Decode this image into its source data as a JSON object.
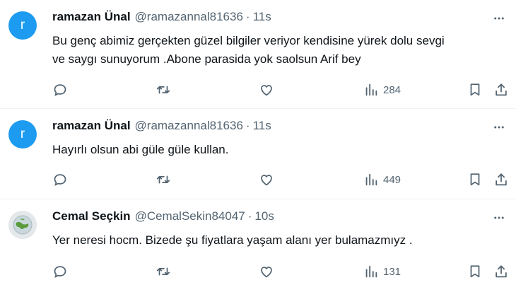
{
  "icons": {
    "reply": "reply-icon",
    "retweet": "retweet-icon",
    "like": "like-icon",
    "views": "views-icon",
    "bookmark": "bookmark-icon",
    "share": "share-icon",
    "more": "more-icon"
  },
  "colors": {
    "avatar_blue": "#1d9bf0",
    "icon_gray": "#536471"
  },
  "tweets": [
    {
      "avatar_letter": "r",
      "name": "ramazan Ünal",
      "handle": "@ramazannal81636",
      "separator": "·",
      "time": "11s",
      "text_lines": [
        "Bu genç abimiz  gerçekten güzel bilgiler veriyor kendisine yürek dolu sevgi",
        "ve saygı sunuyorum .Abone  parasida yok saolsun Arif bey"
      ],
      "views": "284"
    },
    {
      "avatar_letter": "r",
      "name": "ramazan Ünal",
      "handle": "@ramazannal81636",
      "separator": "·",
      "time": "11s",
      "text_lines": [
        "Hayırlı olsun abi güle güle kullan."
      ],
      "views": "449"
    },
    {
      "avatar_letter": "",
      "name": "Cemal Seçkin",
      "handle": "@CemalSekin84047",
      "separator": "·",
      "time": "10s",
      "text_lines": [
        "Yer neresi hocm. Bizede şu fiyatlara yaşam alanı yer bulamazmıyz ."
      ],
      "views": "131"
    }
  ]
}
